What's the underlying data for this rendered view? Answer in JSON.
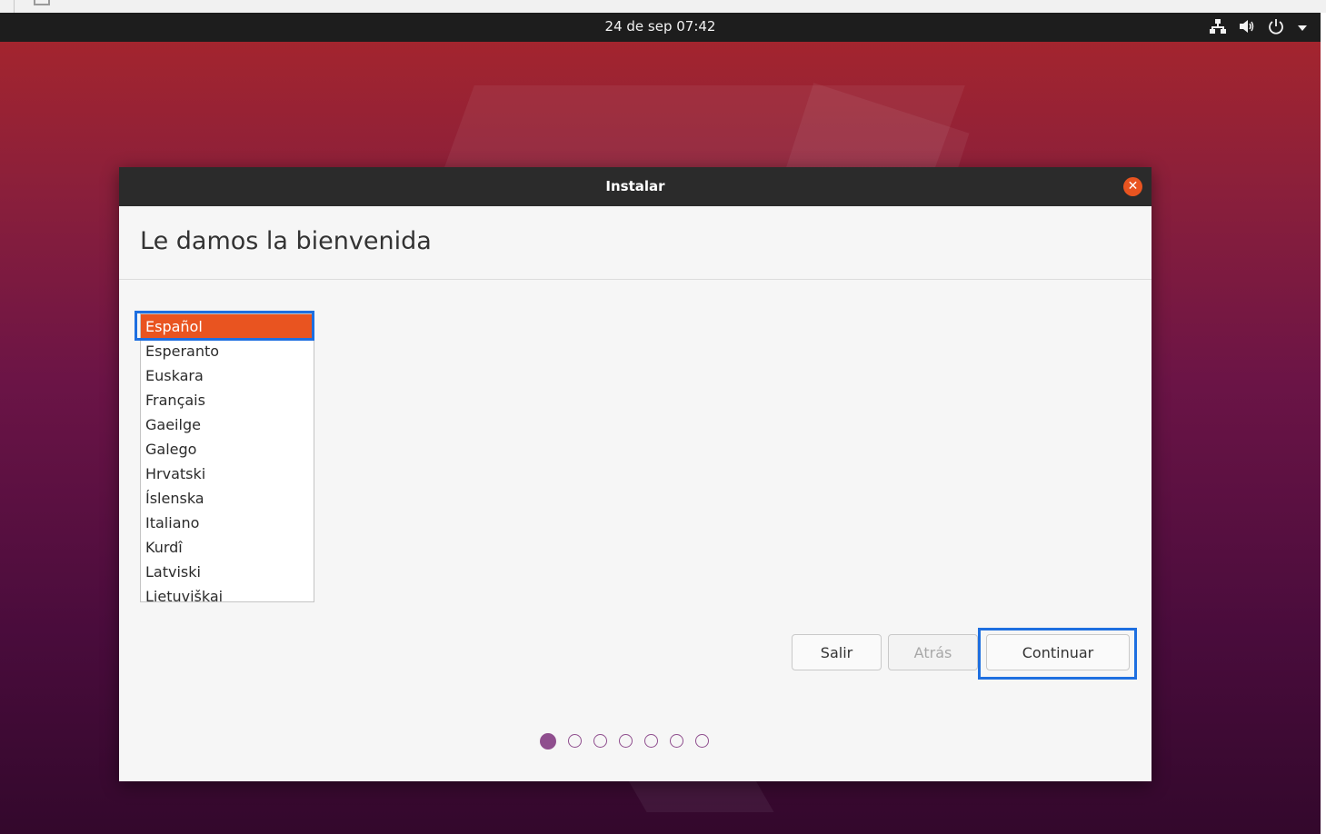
{
  "topbar": {
    "clock": "24 de sep  07:42",
    "icons": [
      "network-icon",
      "volume-icon",
      "power-icon",
      "menu-arrow-icon"
    ]
  },
  "window": {
    "title": "Instalar",
    "heading": "Le damos la bienvenida",
    "languages": [
      "Español",
      "Esperanto",
      "Euskara",
      "Français",
      "Gaeilge",
      "Galego",
      "Hrvatski",
      "Íslenska",
      "Italiano",
      "Kurdî",
      "Latviski",
      "Lietuviškai"
    ],
    "selected_language": "Español",
    "buttons": {
      "quit": "Salir",
      "back": "Atrás",
      "continue": "Continuar"
    },
    "progress": {
      "total_steps": 7,
      "current_step": 1
    }
  },
  "colors": {
    "accent": "#e95420",
    "focus": "#1e6fe0",
    "progress": "#8f4e8e"
  }
}
